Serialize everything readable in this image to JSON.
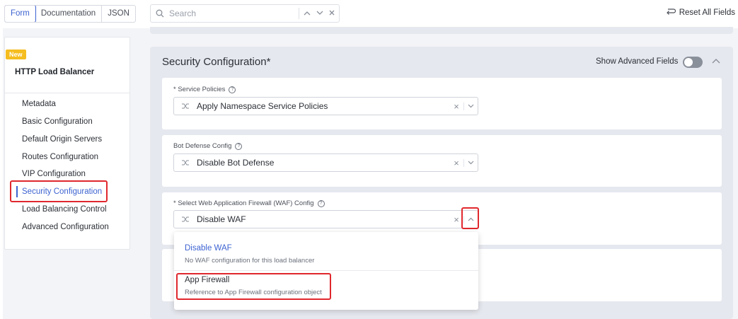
{
  "tabs": [
    {
      "label": "Form"
    },
    {
      "label": "Documentation"
    },
    {
      "label": "JSON"
    }
  ],
  "search": {
    "placeholder": "Search"
  },
  "reset_label": "Reset All Fields",
  "sidebar": {
    "badge": "New",
    "title": "HTTP Load Balancer",
    "items": [
      {
        "label": "Metadata"
      },
      {
        "label": "Basic Configuration"
      },
      {
        "label": "Default Origin Servers"
      },
      {
        "label": "Routes Configuration"
      },
      {
        "label": "VIP Configuration"
      },
      {
        "label": "Security Configuration"
      },
      {
        "label": "Load Balancing Control"
      },
      {
        "label": "Advanced Configuration"
      }
    ],
    "active_index": 5
  },
  "section": {
    "title": "Security Configuration*",
    "advanced_label": "Show Advanced Fields",
    "advanced_enabled": false
  },
  "fields": [
    {
      "label": "* Service Policies",
      "value": "Apply Namespace Service Policies"
    },
    {
      "label": "Bot Defense Config",
      "value": "Disable Bot Defense"
    },
    {
      "label": "* Select Web Application Firewall (WAF) Config",
      "value": "Disable WAF"
    }
  ],
  "dropdown": {
    "options": [
      {
        "title": "Disable WAF",
        "desc": "No WAF configuration for this load balancer"
      },
      {
        "title": "App Firewall",
        "desc": "Reference to App Firewall configuration object"
      }
    ]
  },
  "colors": {
    "accent": "#3d63d1",
    "highlight": "#e0282e",
    "badge": "#f5bd1f",
    "panel": "#e6e8ef"
  },
  "icons": {
    "search": "search-icon",
    "reset": "reset-icon",
    "select": "shuffle-icon",
    "info": "info-icon"
  }
}
